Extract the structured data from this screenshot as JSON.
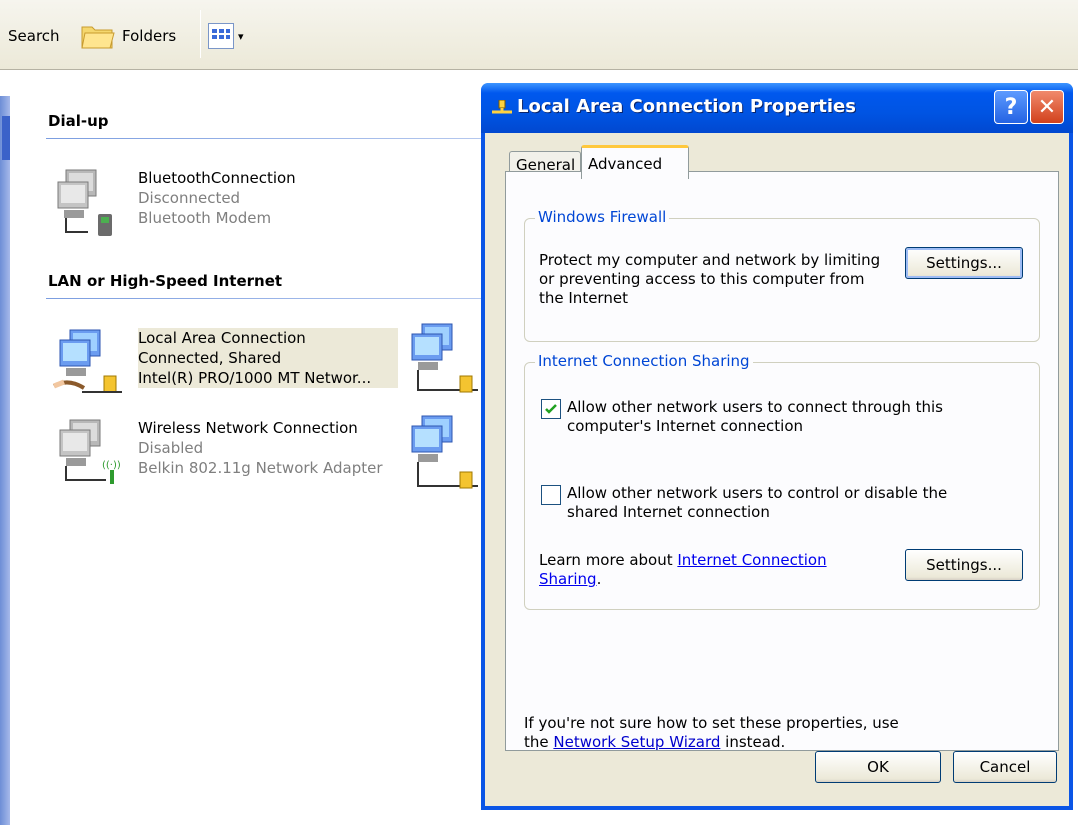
{
  "toolbar": {
    "search_label": "Search",
    "folders_label": "Folders",
    "views_arrow": "▾"
  },
  "groups": {
    "dialup": "Dial-up",
    "lan": "LAN or High-Speed Internet"
  },
  "connections": {
    "bluetooth": {
      "name": "BluetoothConnection",
      "status": "Disconnected",
      "device": "Bluetooth Modem"
    },
    "lan": {
      "name": "Local Area Connection",
      "status": "Connected, Shared",
      "device": "Intel(R) PRO/1000 MT Networ..."
    },
    "wifi": {
      "name": "Wireless Network Connection",
      "status": "Disabled",
      "device": "Belkin 802.11g Network Adapter"
    }
  },
  "dialog": {
    "title": "Local Area Connection Properties",
    "help_glyph": "?",
    "close_glyph": "✕",
    "tabs": {
      "general": "General",
      "advanced": "Advanced"
    },
    "firewall": {
      "title": "Windows Firewall",
      "description_line1": "Protect my computer and network by limiting",
      "description_line2": "or preventing access to this computer from",
      "description_line3": "the Internet",
      "settings_label": "Settings..."
    },
    "ics": {
      "title": "Internet Connection Sharing",
      "allow_connect_line1": "Allow other network users to connect through this",
      "allow_connect_line2": "computer's Internet connection",
      "allow_connect_checked": true,
      "allow_control_line1": "Allow other network users to control or disable the",
      "allow_control_line2": "shared Internet connection",
      "allow_control_checked": false,
      "learn_more_prefix": "Learn more about ",
      "learn_more_link1": "Internet Connection",
      "learn_more_link2": "Sharing",
      "learn_more_suffix": ".",
      "settings_label": "Settings..."
    },
    "note": {
      "line1": "If you're not sure how to set these properties, use",
      "line2_prefix": "the ",
      "line2_link": "Network Setup Wizard",
      "line2_suffix": " instead."
    },
    "ok_label": "OK",
    "cancel_label": "Cancel"
  },
  "colors": {
    "titlebar": "#0054e3",
    "groupbox_title": "#0046d5",
    "link": "#0000ee",
    "dialog_face": "#ece9d8"
  }
}
